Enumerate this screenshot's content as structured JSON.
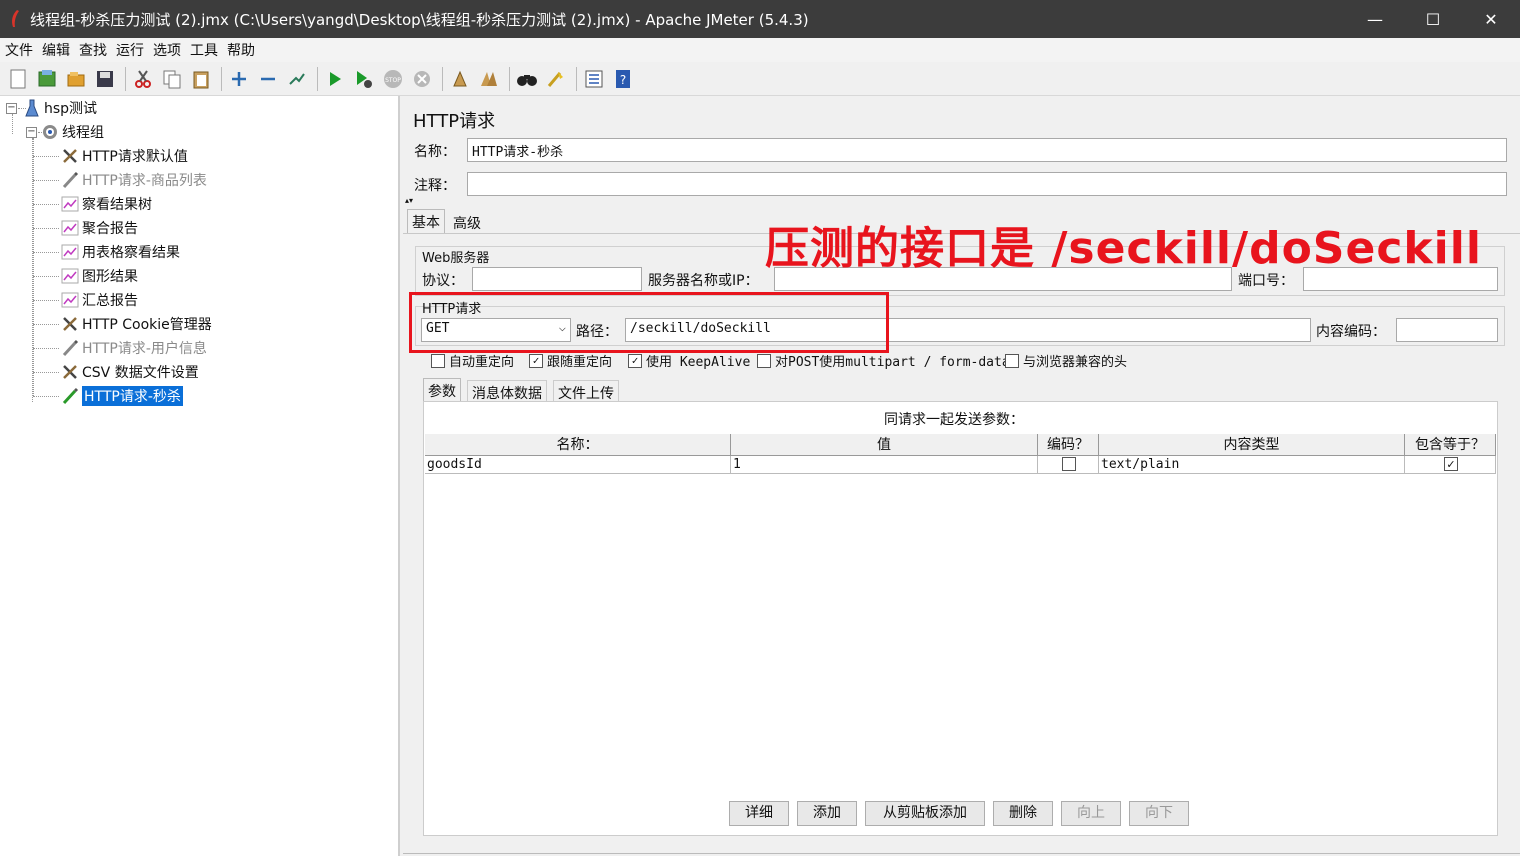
{
  "window": {
    "title": "线程组-秒杀压力测试 (2).jmx (C:\\Users\\yangd\\Desktop\\线程组-秒杀压力测试 (2).jmx) - Apache JMeter (5.4.3)",
    "minimize": "—",
    "maximize": "☐",
    "close": "✕"
  },
  "menu": [
    "文件",
    "编辑",
    "查找",
    "运行",
    "选项",
    "工具",
    "帮助"
  ],
  "tree": {
    "root": "hsp测试",
    "thread_group": "线程组",
    "items": [
      {
        "label": "HTTP请求默认值",
        "icon": "wrench-icon",
        "disabled": false
      },
      {
        "label": "HTTP请求-商品列表",
        "icon": "pen-icon",
        "disabled": true
      },
      {
        "label": "察看结果树",
        "icon": "chart-icon",
        "disabled": false
      },
      {
        "label": "聚合报告",
        "icon": "chart-icon",
        "disabled": false
      },
      {
        "label": "用表格察看结果",
        "icon": "chart-icon",
        "disabled": false
      },
      {
        "label": "图形结果",
        "icon": "chart-icon",
        "disabled": false
      },
      {
        "label": "汇总报告",
        "icon": "chart-icon",
        "disabled": false
      },
      {
        "label": "HTTP Cookie管理器",
        "icon": "wrench-icon",
        "disabled": false
      },
      {
        "label": "HTTP请求-用户信息",
        "icon": "pen-icon",
        "disabled": true
      },
      {
        "label": "CSV 数据文件设置",
        "icon": "wrench-icon",
        "disabled": false
      },
      {
        "label": "HTTP请求-秒杀",
        "icon": "pen-icon",
        "disabled": false,
        "selected": true
      }
    ]
  },
  "panel": {
    "heading": "HTTP请求",
    "name_label": "名称：",
    "name_value": "HTTP请求-秒杀",
    "comment_label": "注释：",
    "comment_value": "",
    "tabs": [
      "基本",
      "高级"
    ],
    "web_server": {
      "group_label": "Web服务器",
      "protocol_label": "协议：",
      "protocol_value": "",
      "server_label": "服务器名称或IP：",
      "server_value": "",
      "port_label": "端口号：",
      "port_value": ""
    },
    "http_request": {
      "group_label": "HTTP请求",
      "method": "GET",
      "path_label": "路径：",
      "path_value": "/seckill/doSeckill",
      "encoding_label": "内容编码：",
      "encoding_value": ""
    },
    "options": [
      {
        "label": "自动重定向",
        "checked": false
      },
      {
        "label": "跟随重定向",
        "checked": true
      },
      {
        "label": "使用 KeepAlive",
        "checked": true
      },
      {
        "label": "对POST使用multipart / form-data",
        "checked": false
      },
      {
        "label": "与浏览器兼容的头",
        "checked": false
      }
    ],
    "sub_tabs": [
      "参数",
      "消息体数据",
      "文件上传"
    ],
    "params_caption": "同请求一起发送参数：",
    "columns": [
      "名称：",
      "值",
      "编码？",
      "内容类型",
      "包含等于？"
    ],
    "rows": [
      {
        "name": "goodsId",
        "value": "1",
        "encode": false,
        "content_type": "text/plain",
        "include_equals": true
      }
    ],
    "buttons": [
      {
        "label": "详细",
        "enabled": true
      },
      {
        "label": "添加",
        "enabled": true
      },
      {
        "label": "从剪贴板添加",
        "enabled": true
      },
      {
        "label": "删除",
        "enabled": true
      },
      {
        "label": "向上",
        "enabled": false
      },
      {
        "label": "向下",
        "enabled": false
      }
    ]
  },
  "annotation": {
    "text": "压测的接口是 /seckill/doSeckill",
    "color": "#e8141d"
  }
}
